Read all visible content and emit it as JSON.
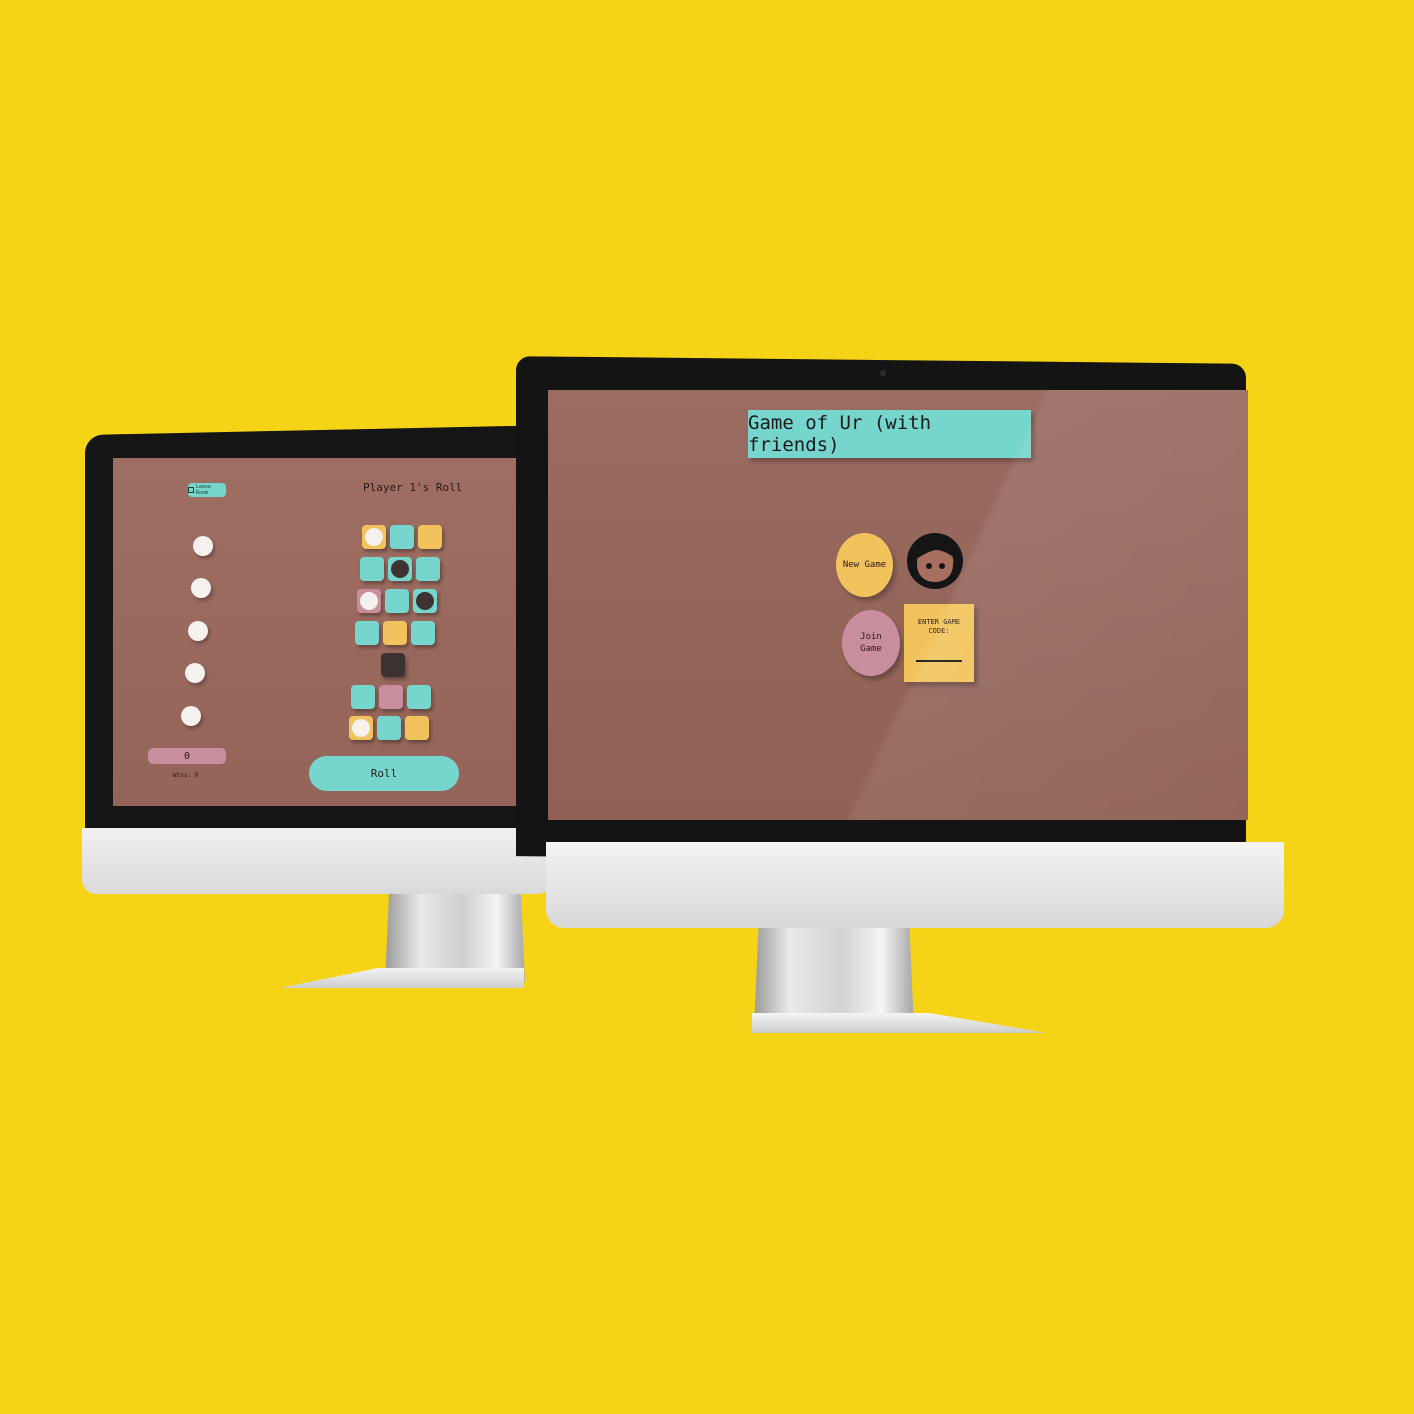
{
  "colors": {
    "background": "#f5d417",
    "screen": "#9a6c62",
    "teal": "#76d5cd",
    "gold": "#f2c35c",
    "pink": "#c98e9e",
    "dark_piece": "#3b3231",
    "white_piece": "#f4f1ee"
  },
  "game_screen": {
    "leave_button": {
      "icon": "door-exit-icon",
      "label": "Leave Room"
    },
    "roll_title": "Player 1's Roll",
    "score": "0",
    "wins_label": "Wins: 0",
    "roll_button": "Roll",
    "unplayed_pieces_count": 5,
    "board_rows": [
      [
        "gold-white",
        "teal",
        "gold"
      ],
      [
        "teal",
        "teal-black",
        "teal"
      ],
      [
        "pink-white",
        "teal",
        "teal-black"
      ],
      [
        "teal",
        "gold",
        "teal"
      ],
      [
        "",
        "dark-black",
        ""
      ],
      [
        "teal",
        "pink",
        "teal"
      ],
      [
        "gold-white",
        "teal",
        "gold"
      ]
    ]
  },
  "landing_screen": {
    "title": "Game of Ur (with friends)",
    "new_game_label": "New Game",
    "join_game_label": "Join Game",
    "avatar_icon": "person-avatar-icon",
    "code_label": "ENTER GAME CODE:",
    "code_value": ""
  }
}
